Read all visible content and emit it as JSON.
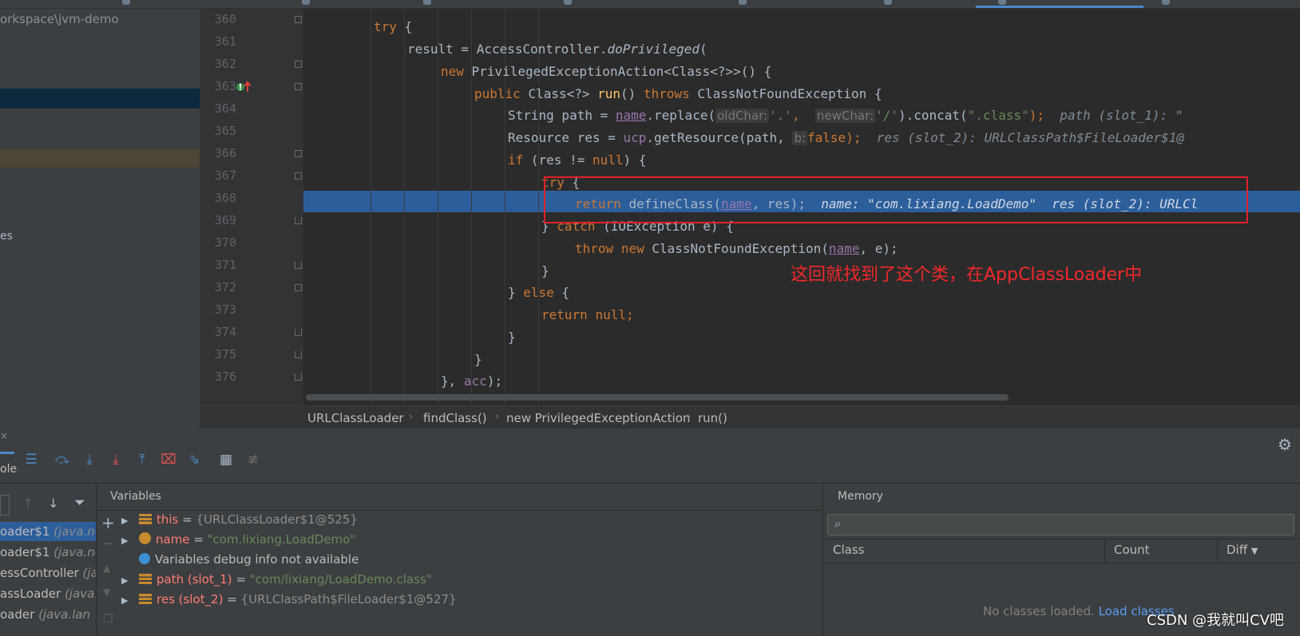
{
  "project": {
    "path": "orkspace\\jvm-demo",
    "fragment": "es"
  },
  "editor": {
    "line_numbers": [
      "360",
      "361",
      "362",
      "363",
      "364",
      "365",
      "366",
      "367",
      "368",
      "369",
      "370",
      "371",
      "372",
      "373",
      "374",
      "375",
      "376"
    ],
    "code": {
      "l360": "try",
      "l361_a": "result = AccessController.",
      "l361_b": "doPrivileged",
      "l362_a": "new",
      "l362_b": "PrivilegedExceptionAction<Class<?>>() {",
      "l363_a": "public",
      "l363_b": "Class<?>",
      "l363_c": "run",
      "l363_d": "throws",
      "l363_e": "ClassNotFoundException {",
      "l364_a": "String path = ",
      "l364_b": "name",
      "l364_c": ".replace(",
      "l364_hint1": "oldChar:",
      "l364_d": "'.'",
      "l364_hint2": "newChar:",
      "l364_e": "'/'",
      "l364_f": ").concat(",
      "l364_g": "\".class\"",
      "l364_h": ");",
      "l364_inline": "path (slot_1): \"",
      "l365_a": "Resource res = ",
      "l365_b": "ucp",
      "l365_c": ".getResource(path, ",
      "l365_hint": "b:",
      "l365_d": "false",
      "l365_e": ");",
      "l365_inline": "res (slot_2): URLClassPath$FileLoader$1@",
      "l366_a": "if",
      "l366_b": "(res != ",
      "l366_c": "null",
      "l366_d": ") {",
      "l367": "try",
      "l368_a": "return",
      "l368_b": "defineClass(",
      "l368_c": "name",
      "l368_d": ", res);",
      "l368_inline": "name: \"com.lixiang.LoadDemo\"  res (slot_2): URLCl",
      "l369_a": "} ",
      "l369_b": "catch",
      "l369_c": " (IOException e) {",
      "l370_a": "throw",
      "l370_b": "new",
      "l370_c": "ClassNotFoundException(",
      "l370_d": "name",
      "l370_e": ", e);",
      "l371": "}",
      "l372_a": "} ",
      "l372_b": "else",
      "l372_c": " {",
      "l373_a": "return",
      "l373_b": "null",
      "l373_c": ";",
      "l374": "}",
      "l375": "}",
      "l376_a": "}, ",
      "l376_b": "acc",
      "l376_c": ");"
    },
    "annotation": "这回就找到了这个类，在AppClassLoader中"
  },
  "breadcrumb": {
    "items": [
      "URLClassLoader",
      "findClass()",
      "new PrivilegedExceptionAction",
      "run()"
    ]
  },
  "debug": {
    "toolbar_label": "ole",
    "variables_title": "Variables",
    "frames": [
      {
        "name": "oader$1",
        "pkg": "(java.net"
      },
      {
        "name": "oader$1",
        "pkg": "(java.net"
      },
      {
        "name": "essController",
        "pkg": "(ja"
      },
      {
        "name": "assLoader",
        "pkg": "(java.n"
      },
      {
        "name": "oader",
        "pkg": "(java.lan"
      }
    ],
    "variables": [
      {
        "name": "this",
        "eq": " = ",
        "value": "{URLClassLoader$1@525}"
      },
      {
        "name": "name",
        "eq": " = ",
        "value": "\"com.lixiang.LoadDemo\""
      },
      {
        "info": "Variables debug info not available"
      },
      {
        "name": "path (slot_1)",
        "eq": " = ",
        "value": "\"com/lixiang/LoadDemo.class\""
      },
      {
        "name": "res (slot_2)",
        "eq": " = ",
        "value": "{URLClassPath$FileLoader$1@527}"
      }
    ]
  },
  "memory": {
    "title": "Memory",
    "col_class": "Class",
    "col_count": "Count",
    "col_diff": "Diff",
    "empty_text": "No classes loaded.",
    "load_link": "Load classes"
  },
  "watermark": "CSDN @我就叫CV吧",
  "colors": {
    "keyword": "#cc7832",
    "method": "#ffc66d",
    "string": "#6a8759",
    "field": "#9876aa",
    "exec_line": "#2d5e9c",
    "annotation_red": "#e0222a",
    "link": "#589df6"
  }
}
